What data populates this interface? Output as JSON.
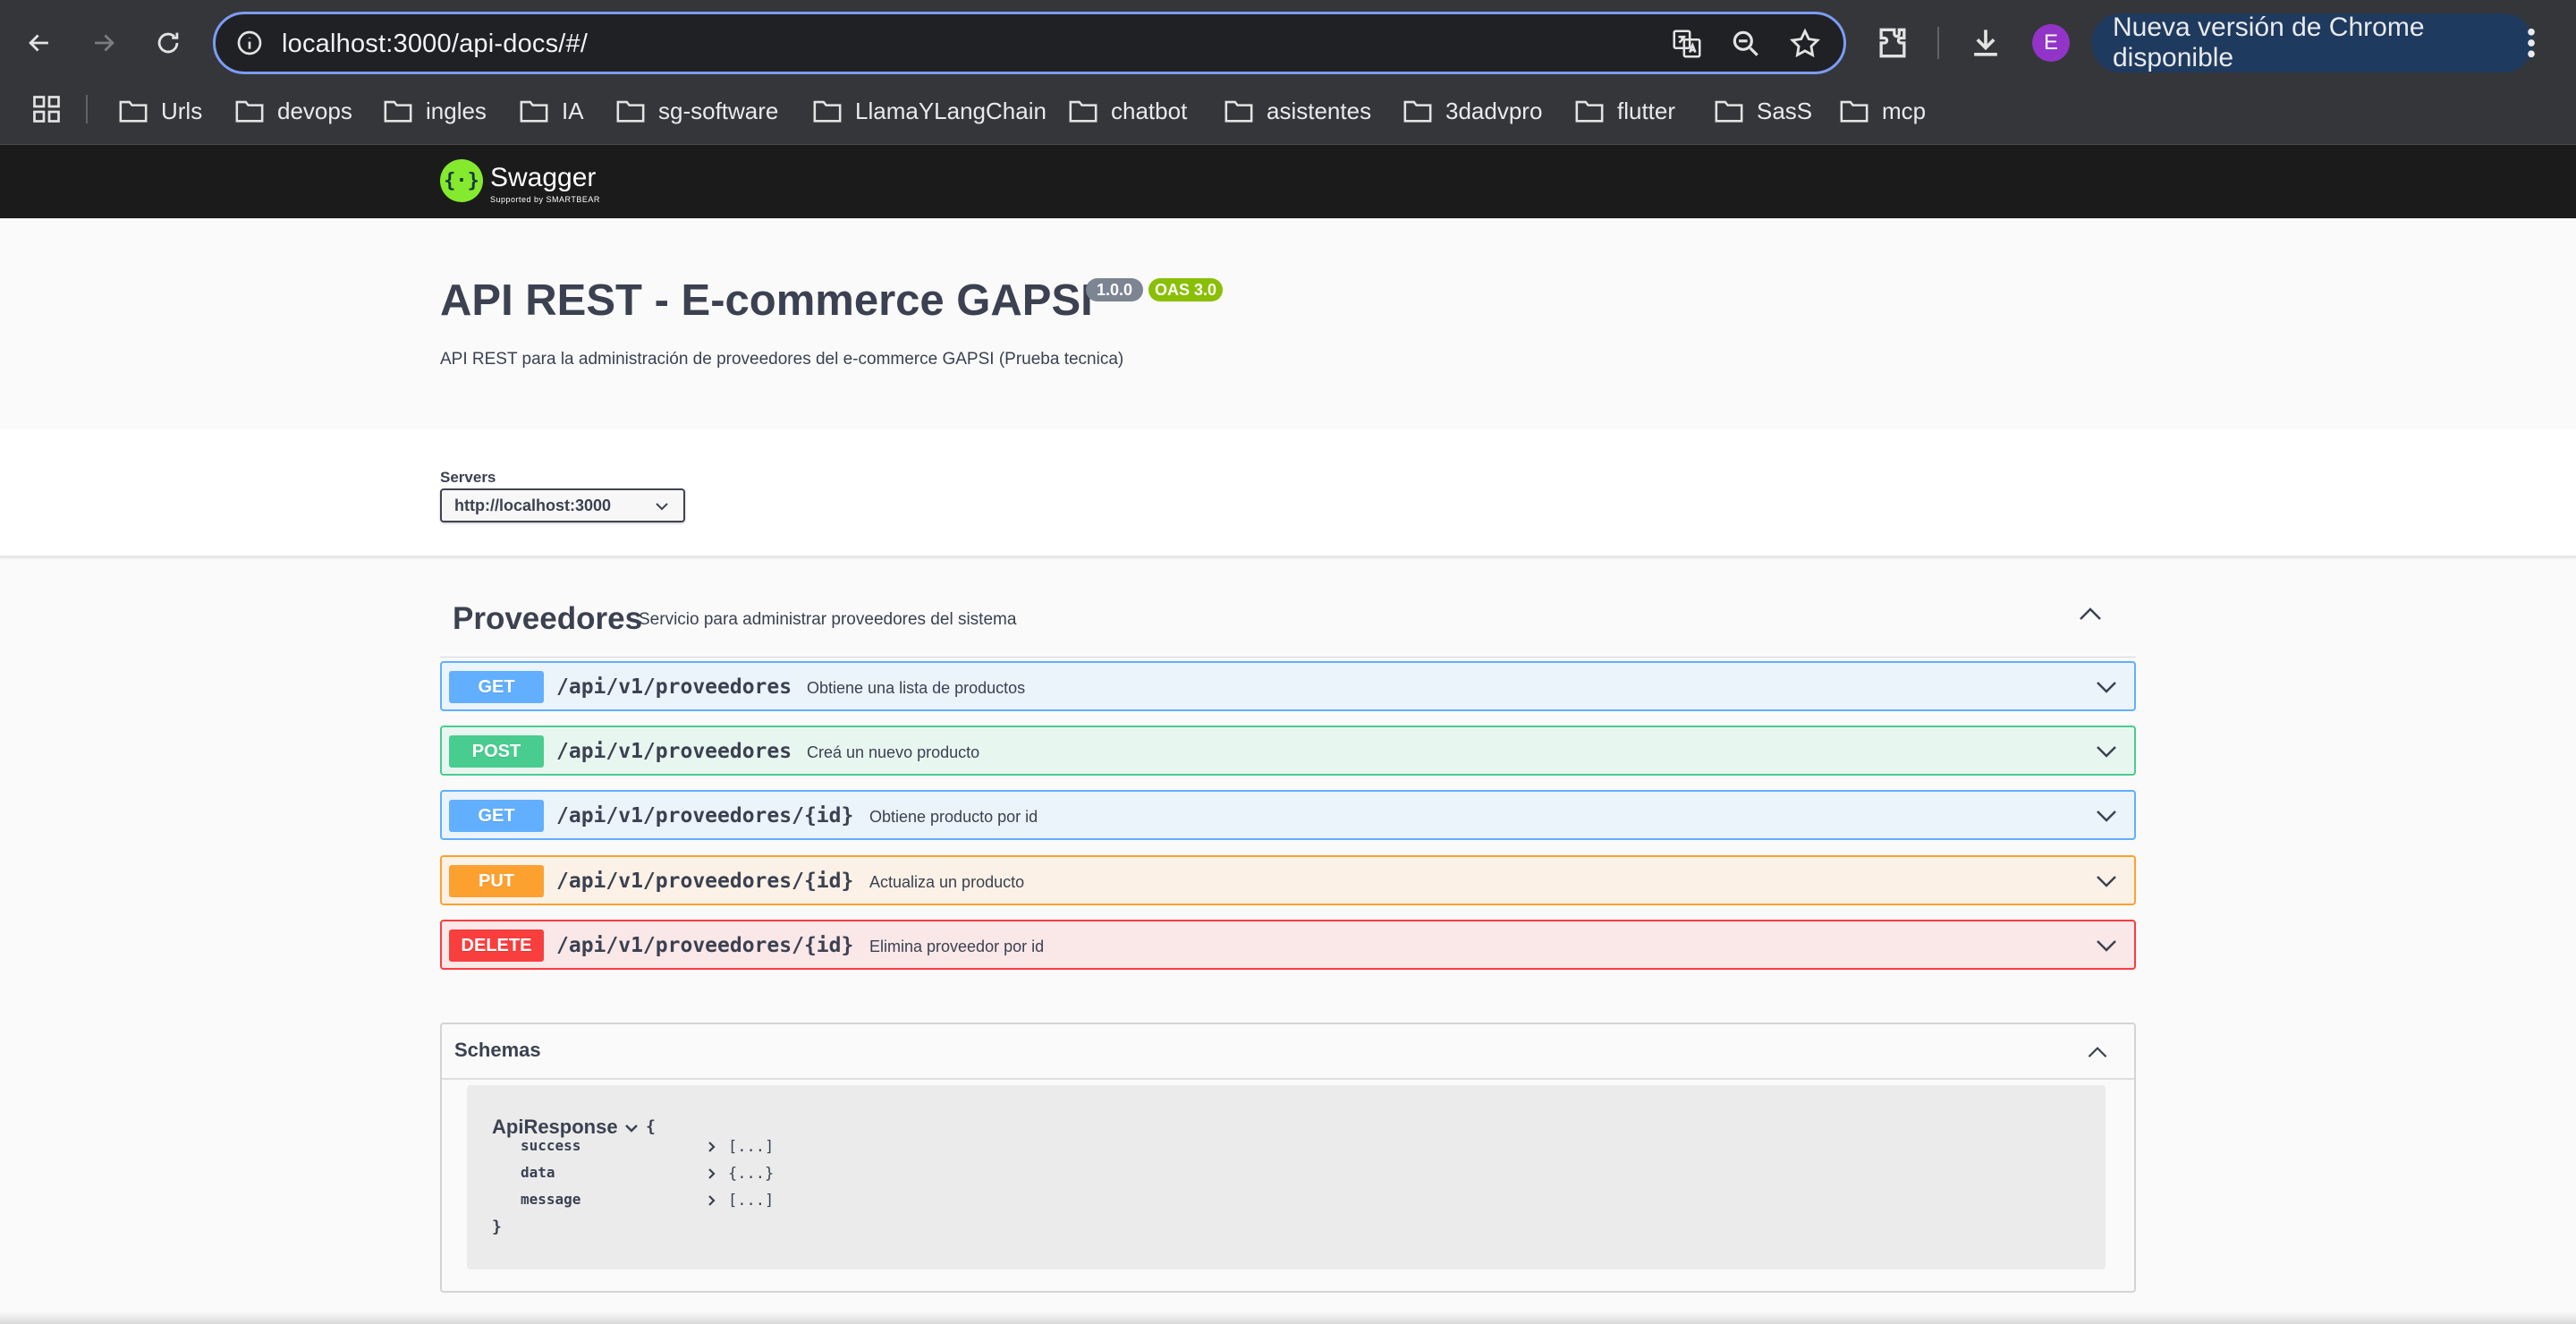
{
  "browser": {
    "url": "localhost:3000/api-docs/#/",
    "avatar_letter": "E",
    "update_label": "Nueva versión de Chrome disponible",
    "bookmarks": [
      "Urls",
      "devops",
      "ingles",
      "IA",
      "sg-software",
      "LlamaYLangChain",
      "chatbot",
      "asistentes",
      "3dadvpro",
      "flutter",
      "SasS",
      "mcp"
    ]
  },
  "swagger": {
    "logo_text": "Swagger",
    "logo_sub": "Supported by SMARTBEAR",
    "title": "API REST - E-commerce GAPSI",
    "version": "1.0.0",
    "oas": "OAS 3.0",
    "description": "API REST para la administración de proveedores del e-commerce GAPSI (Prueba tecnica)",
    "servers_label": "Servers",
    "server_selected": "http://localhost:3000",
    "tag": {
      "name": "Proveedores",
      "description": "Servicio para administrar proveedores del sistema"
    },
    "operations": [
      {
        "method": "GET",
        "path": "/api/v1/proveedores",
        "summary": "Obtiene una lista de productos"
      },
      {
        "method": "POST",
        "path": "/api/v1/proveedores",
        "summary": "Creá un nuevo producto"
      },
      {
        "method": "GET",
        "path": "/api/v1/proveedores/{id}",
        "summary": "Obtiene producto por id"
      },
      {
        "method": "PUT",
        "path": "/api/v1/proveedores/{id}",
        "summary": "Actualiza un producto"
      },
      {
        "method": "DELETE",
        "path": "/api/v1/proveedores/{id}",
        "summary": "Elimina proveedor por id"
      }
    ],
    "schemas": {
      "title": "Schemas",
      "model": {
        "name": "ApiResponse",
        "open_brace": "{",
        "close_brace": "}",
        "properties": [
          {
            "name": "success",
            "value": "[...]"
          },
          {
            "name": "data",
            "value": "{...}"
          },
          {
            "name": "message",
            "value": "[...]"
          }
        ]
      }
    }
  },
  "colors": {
    "get": "#61affe",
    "post": "#49cc90",
    "put": "#fca130",
    "delete": "#f93e3e",
    "version_badge": "#7d8492",
    "oas_badge": "#89bf04"
  }
}
